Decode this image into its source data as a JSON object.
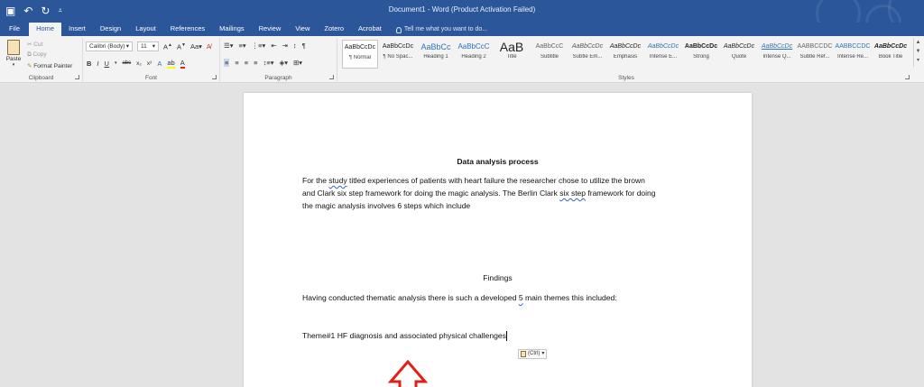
{
  "window": {
    "title": "Document1 - Word (Product Activation Failed)"
  },
  "tabs": [
    "File",
    "Home",
    "Insert",
    "Design",
    "Layout",
    "References",
    "Mailings",
    "Review",
    "View",
    "Zotero",
    "Acrobat"
  ],
  "tell_me": "Tell me what you want to do...",
  "clipboard": {
    "paste": "Paste",
    "cut": "Cut",
    "copy": "Copy",
    "format_painter": "Format Painter",
    "label": "Clipboard"
  },
  "font": {
    "name": "Calibri (Body)",
    "size": "11",
    "label": "Font"
  },
  "paragraph": {
    "label": "Paragraph"
  },
  "styles": {
    "label": "Styles",
    "items": [
      {
        "preview": "AaBbCcDc",
        "name": "¶ Normal"
      },
      {
        "preview": "AaBbCcDc",
        "name": "¶ No Spac..."
      },
      {
        "preview": "AaBbCc",
        "name": "Heading 1"
      },
      {
        "preview": "AaBbCcC",
        "name": "Heading 2"
      },
      {
        "preview": "AaB",
        "name": "Title"
      },
      {
        "preview": "AaBbCcC",
        "name": "Subtitle"
      },
      {
        "preview": "AaBbCcDc",
        "name": "Subtle Em..."
      },
      {
        "preview": "AaBbCcDc",
        "name": "Emphasis"
      },
      {
        "preview": "AaBbCcDc",
        "name": "Intense E..."
      },
      {
        "preview": "AaBbCcDc",
        "name": "Strong"
      },
      {
        "preview": "AaBbCcDc",
        "name": "Quote"
      },
      {
        "preview": "AaBbCcDc",
        "name": "Intense Q..."
      },
      {
        "preview": "AABBCCDC",
        "name": "Subtle Ref..."
      },
      {
        "preview": "AABBCCDC",
        "name": "Intense Re..."
      },
      {
        "preview": "AaBbCcDc",
        "name": "Book Title"
      }
    ]
  },
  "document": {
    "heading": "Data analysis process",
    "p1": {
      "a": "For the ",
      "b": "study",
      "c": " titled experiences of patients with heart failure the researcher chose to utilize the brown",
      "d": "and Clark six step framework for doing the magic analysis. The Berlin Clark ",
      "e": "six step",
      "f": " framework for doing",
      "g": "the magic analysis involves 6 steps which include"
    },
    "findings": "Findings",
    "p2": {
      "a": "Having conducted thematic analysis there is such a developed ",
      "b": "5",
      "c": " main themes this included:"
    },
    "theme": "Theme#1 HF diagnosis and associated physical challenges",
    "paste_options": "(Ctrl)"
  },
  "colors": {
    "ribbon_blue": "#2b579a",
    "annotation_arrow": "#e0201a"
  }
}
